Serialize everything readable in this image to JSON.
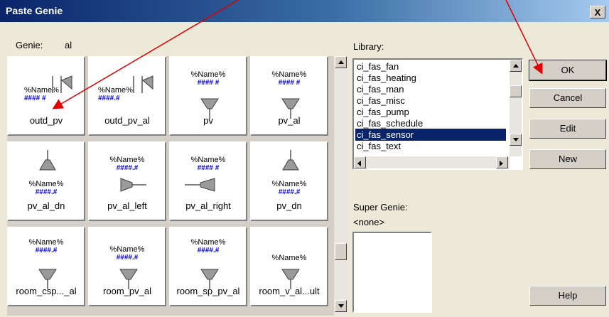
{
  "window": {
    "title": "Paste Genie",
    "close_glyph": "X"
  },
  "genie": {
    "label": "Genie:",
    "value": "al"
  },
  "library": {
    "label": "Library:",
    "items": [
      "ci_fas_fan",
      "ci_fas_heating",
      "ci_fas_man",
      "ci_fas_misc",
      "ci_fas_pump",
      "ci_fas_schedule",
      "ci_fas_sensor",
      "ci_fas_text"
    ],
    "selected": "ci_fas_sensor"
  },
  "super_genie": {
    "label": "Super Genie:",
    "value": "<none>"
  },
  "tiles": [
    {
      "caption": "outd_pv",
      "tag": "%Name%",
      "value": "#### #"
    },
    {
      "caption": "outd_pv_al",
      "tag": "%Name%",
      "value": "####.#"
    },
    {
      "caption": "pv",
      "tag": "%Name%",
      "value": "#### #"
    },
    {
      "caption": "pv_al",
      "tag": "%Name%",
      "value": "#### #"
    },
    {
      "caption": "pv_al_dn",
      "tag": "%Name%",
      "value": "####.#"
    },
    {
      "caption": "pv_al_left",
      "tag": "%Name%",
      "value": "####.#"
    },
    {
      "caption": "pv_al_right",
      "tag": "%Name%",
      "value": "#### #"
    },
    {
      "caption": "pv_dn",
      "tag": "%Name%",
      "value": "####.#"
    },
    {
      "caption": "room_csp..._al",
      "tag": "%Name%",
      "value": "####.#"
    },
    {
      "caption": "room_pv_al",
      "tag": "%Name%",
      "value": "####.#"
    },
    {
      "caption": "room_sp_pv_al",
      "tag": "%Name%",
      "value": "####.#"
    },
    {
      "caption": "room_v_al...ult",
      "tag": "%Name%",
      "value": ""
    }
  ],
  "buttons": {
    "ok": "OK",
    "cancel": "Cancel",
    "edit": "Edit",
    "new": "New",
    "help": "Help"
  },
  "colors": {
    "title_start": "#0a246a",
    "selection": "#0a246a",
    "tag_text": "#0000c0",
    "annotation_arrow": "#e00000"
  }
}
